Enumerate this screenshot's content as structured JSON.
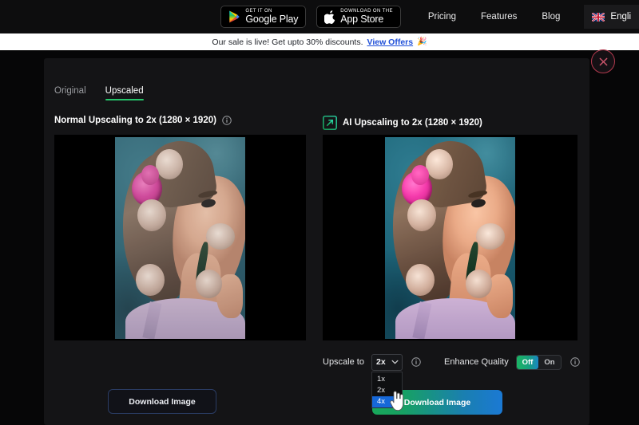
{
  "topnav": {
    "google_play": {
      "small": "GET IT ON",
      "big": "Google Play",
      "icon": "google-play-icon"
    },
    "app_store": {
      "small": "Download on the",
      "big": "App Store",
      "icon": "apple-icon"
    },
    "links": [
      {
        "label": "Pricing"
      },
      {
        "label": "Features"
      },
      {
        "label": "Blog"
      }
    ],
    "language": {
      "label": "Engli",
      "flag": "uk-flag-icon"
    }
  },
  "promo": {
    "text": "Our sale is live! Get upto 30% discounts.",
    "link": "View Offers",
    "emoji": "🎉"
  },
  "modal": {
    "close_icon": "close-icon",
    "tabs": [
      {
        "label": "Original",
        "active": false
      },
      {
        "label": "Upscaled",
        "active": true
      }
    ],
    "left_panel": {
      "title": "Normal Upscaling to 2x (1280 × 1920)",
      "info_icon": "info-icon",
      "download_label": "Download Image"
    },
    "right_panel": {
      "icon": "ai-upscale-icon",
      "title": "AI Upscaling to 2x (1280 × 1920)",
      "download_label": "Download Image",
      "controls": {
        "upscale_label": "Upscale to",
        "upscale_value": "2x",
        "upscale_options": [
          {
            "label": "1x",
            "selected": false
          },
          {
            "label": "2x",
            "selected": false
          },
          {
            "label": "4x",
            "selected": true
          }
        ],
        "upscale_info_icon": "info-icon",
        "enhance_label": "Enhance Quality",
        "enhance_off": "Off",
        "enhance_on": "On",
        "enhance_state": "Off",
        "enhance_info_icon": "info-icon"
      }
    }
  },
  "colors": {
    "accent_green": "#26c46a",
    "gradient_start": "#18a85a",
    "gradient_end": "#1b79d4",
    "promo_link": "#1f4fd8",
    "close_red": "#b33a4e",
    "dropdown_highlight": "#1668d8"
  }
}
